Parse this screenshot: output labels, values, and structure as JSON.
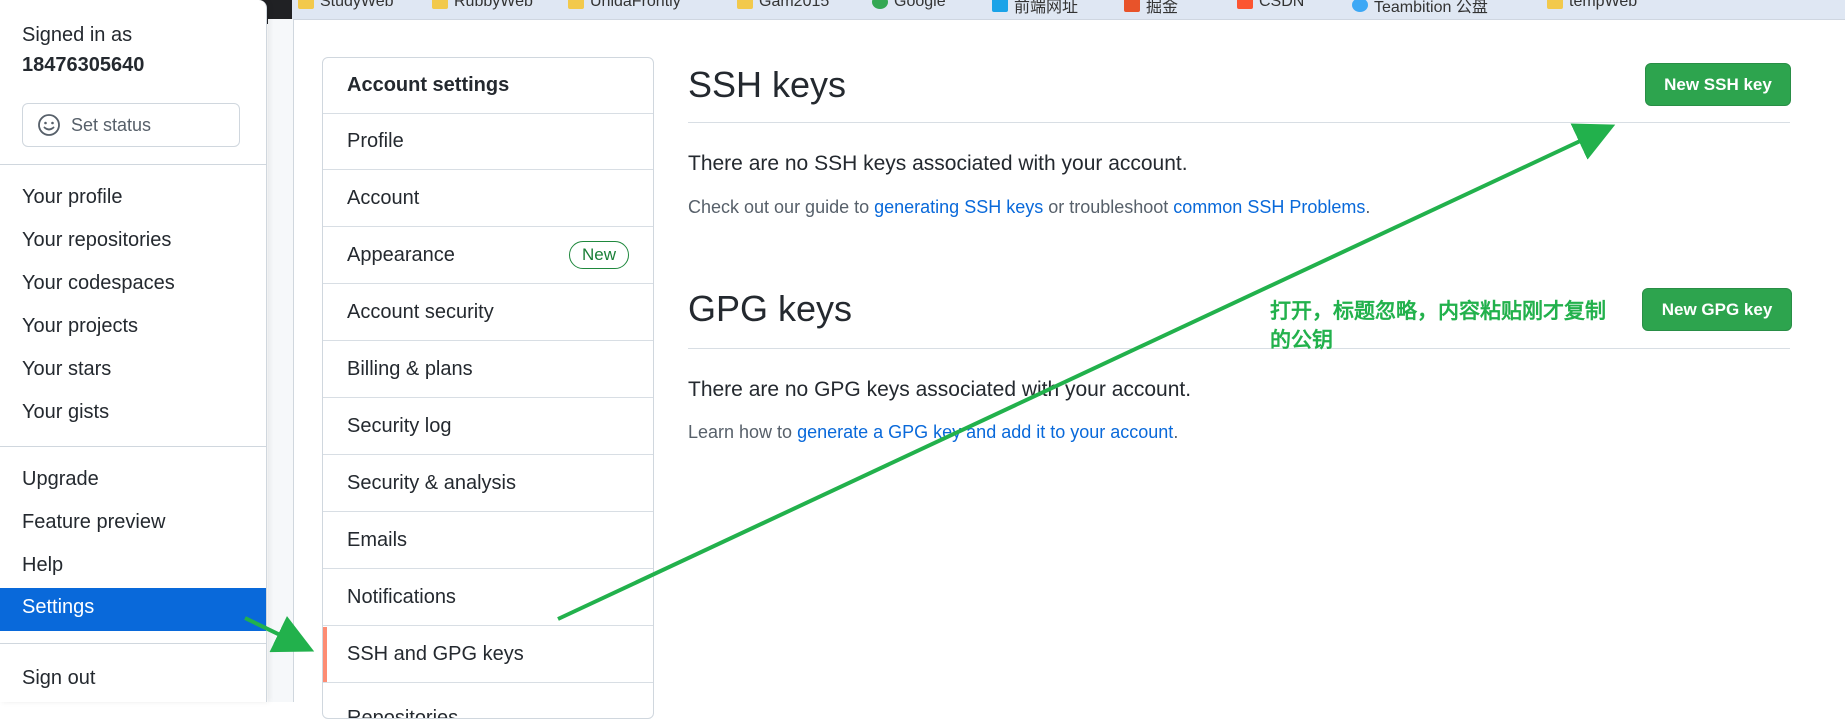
{
  "bookmarks": [
    "StudyWeb",
    "RubbyWeb",
    "UnidaFrontly",
    "Gam2015",
    "Google",
    "前端网址",
    "掘金",
    "CSDN",
    "Teambition 公盘",
    "tempWeb"
  ],
  "dropdown": {
    "signed_in_label": "Signed in as",
    "username": "18476305640",
    "set_status": "Set status",
    "items": [
      "Your profile",
      "Your repositories",
      "Your codespaces",
      "Your projects",
      "Your stars",
      "Your gists"
    ],
    "items2": [
      "Upgrade",
      "Feature preview",
      "Help"
    ],
    "settings": "Settings",
    "sign_out": "Sign out"
  },
  "menu": {
    "header": "Account settings",
    "items": [
      "Profile",
      "Account",
      "Appearance",
      "Account security",
      "Billing & plans",
      "Security log",
      "Security & analysis",
      "Emails",
      "Notifications",
      "SSH and GPG keys",
      "Repositories"
    ],
    "new_badge": "New"
  },
  "ssh": {
    "title": "SSH keys",
    "button": "New SSH key",
    "empty": "There are no SSH keys associated with your account.",
    "guide_prefix": "Check out our guide to ",
    "guide_link1": "generating SSH keys",
    "guide_mid": " or troubleshoot ",
    "guide_link2": "common SSH Problems",
    "guide_suffix": "."
  },
  "gpg": {
    "title": "GPG keys",
    "button": "New GPG key",
    "empty": "There are no GPG keys associated with your account.",
    "learn_prefix": "Learn how to ",
    "learn_link": "generate a GPG key and add it to your account",
    "learn_suffix": "."
  },
  "annotation": "打开，标题忽略，内容粘贴刚才复制的公钥",
  "colors": {
    "accent_blue": "#0969da",
    "green_button": "#2da44e",
    "annotation_green": "#22b14c",
    "selected_marker": "#fd8c73"
  }
}
